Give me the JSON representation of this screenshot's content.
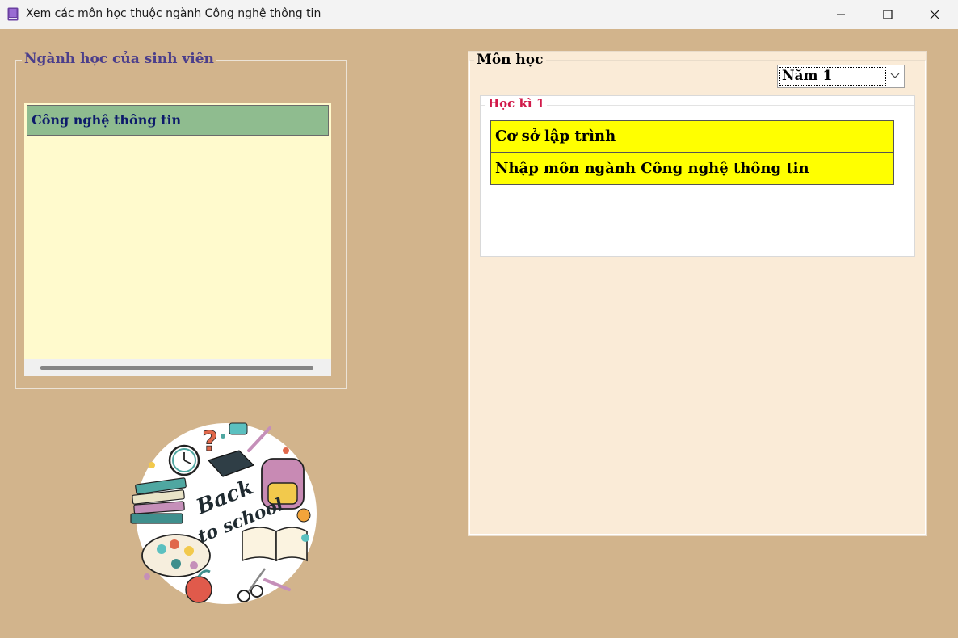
{
  "window": {
    "title": "Xem các môn học thuộc ngành Công nghệ thông tin",
    "icon": "book-icon"
  },
  "major_group": {
    "legend": "Ngành học của sinh viên",
    "items": [
      "Công nghệ thông tin"
    ],
    "selected_index": 0
  },
  "courses_group": {
    "legend": "Môn học",
    "year_select": {
      "value": "Năm 1"
    },
    "semester": {
      "legend": "Học kì 1",
      "courses": [
        "Cơ sở lập trình",
        "Nhập môn ngành Công nghệ thông tin"
      ]
    }
  },
  "illustration": {
    "text_line1": "Back",
    "text_line2": "to school"
  },
  "colors": {
    "background": "#d2b48c",
    "list_background": "#fffacd",
    "selected_item": "#8fbc8f",
    "panel_background": "#faebd7",
    "course_background": "#ffff00",
    "semester_legend": "#d11a4a",
    "major_legend": "#4b3e8b"
  }
}
